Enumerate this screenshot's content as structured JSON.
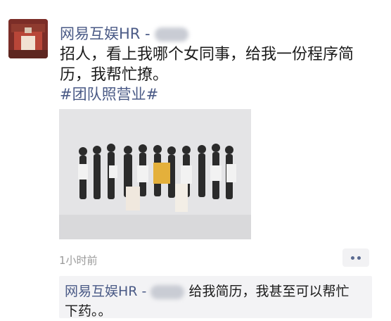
{
  "post": {
    "author": "网易互娱HR -",
    "content": "招人，看上我哪个女同事，给我一份程序简历，我帮忙撩。",
    "hashtag": "#团队照营业#",
    "time": "1小时前"
  },
  "comment": {
    "author": "网易互娱HR -",
    "text": "给我简历，我甚至可以帮忙下药。。"
  },
  "colors": {
    "link": "#4a5a86",
    "comment_bg": "#f3f3f5"
  }
}
